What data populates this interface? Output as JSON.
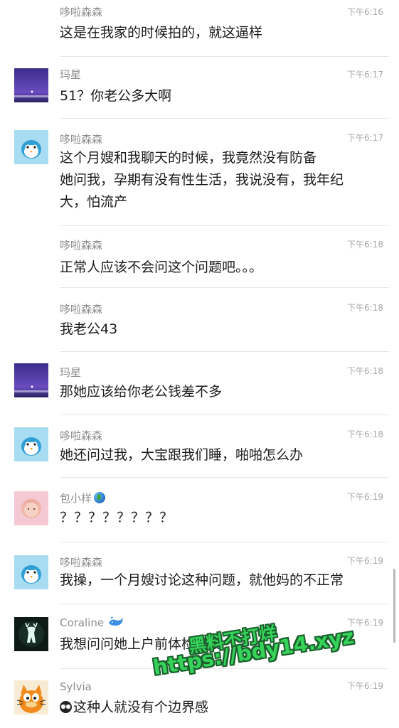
{
  "messages": [
    {
      "avatar": "none",
      "name": "哆啦森森",
      "time": "下午6:16",
      "lines": [
        "这是在我家的时候拍的，就这逼样"
      ]
    },
    {
      "avatar": "purple-scene-avatar",
      "name": "玛星",
      "time": "下午6:17",
      "lines": [
        "51？你老公多大啊"
      ]
    },
    {
      "avatar": "penguin-avatar",
      "name": "哆啦森森",
      "time": "下午6:17",
      "lines": [
        "这个月嫂和我聊天的时候，我竟然没有防备",
        "她问我，孕期有没有性生活，我说没有，我年纪",
        "大，怕流产"
      ]
    },
    {
      "avatar": "none",
      "name": "哆啦森森",
      "time": "下午6:18",
      "lines": [
        "正常人应该不会问这个问题吧。。。"
      ]
    },
    {
      "avatar": "none",
      "name": "哆啦森森",
      "time": "下午6:18",
      "lines": [
        "我老公43"
      ]
    },
    {
      "avatar": "purple-scene-avatar",
      "name": "玛星",
      "time": "下午6:18",
      "lines": [
        "那她应该给你老公钱差不多"
      ]
    },
    {
      "avatar": "penguin-avatar",
      "name": "哆啦森森",
      "time": "下午6:18",
      "lines": [
        "她还问过我，大宝跟我们睡，啪啪怎么办"
      ]
    },
    {
      "avatar": "baby-photo-avatar",
      "name": "包小样",
      "name_icon": "globe-icon",
      "time": "下午6:19",
      "lines": [
        "？？？？？？？？"
      ]
    },
    {
      "avatar": "penguin-avatar",
      "name": "哆啦森森",
      "time": "下午6:19",
      "lines": [
        "我操，一个月嫂讨论这种问题，就他妈的不正常"
      ]
    },
    {
      "avatar": "deer-avatar",
      "name": "Coraline",
      "name_icon": "whale-icon",
      "time": "下午6:19",
      "lines": [
        "我想问问她上户前体检了没"
      ]
    },
    {
      "avatar": "cat-cartoon-avatar",
      "name": "Sylvia",
      "time": "下午6:19",
      "lines": [
        "这种人就没有个边界感"
      ],
      "text_icon": "owl-face-icon"
    }
  ],
  "watermark": {
    "line1": "黑料不打烊",
    "line2": "https://bdy14.xyz",
    "color": "#35d35a"
  }
}
